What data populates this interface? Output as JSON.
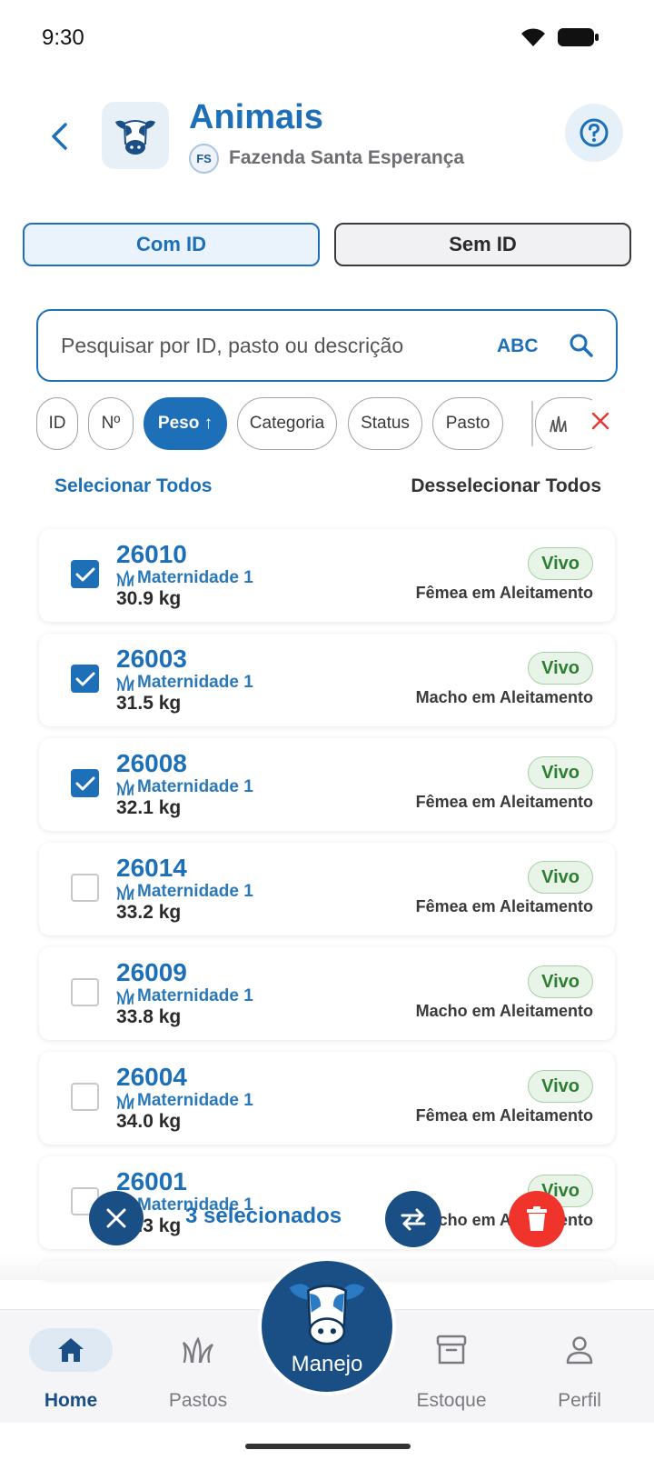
{
  "status_bar": {
    "time": "9:30"
  },
  "header": {
    "title": "Animais",
    "farm_initials": "FS",
    "farm_name": "Fazenda Santa Esperança"
  },
  "segments": {
    "with_id": "Com ID",
    "without_id": "Sem ID"
  },
  "search": {
    "placeholder": "Pesquisar por ID, pasto ou descrição",
    "mode_label": "ABC"
  },
  "filters": {
    "chips": [
      {
        "label": "ID"
      },
      {
        "label": "Nº"
      },
      {
        "label": "Peso ↑",
        "active": true
      },
      {
        "label": "Categoria"
      },
      {
        "label": "Status"
      },
      {
        "label": "Pasto"
      }
    ]
  },
  "selection": {
    "select_all": "Selecionar Todos",
    "deselect_all": "Desselecionar Todos",
    "count_label": "3 selecionados"
  },
  "animals": [
    {
      "id": "26010",
      "pasture": "Maternidade 1",
      "weight": "30.9 kg",
      "status": "Vivo",
      "category": "Fêmea em Aleitamento",
      "checked": true
    },
    {
      "id": "26003",
      "pasture": "Maternidade 1",
      "weight": "31.5 kg",
      "status": "Vivo",
      "category": "Macho em Aleitamento",
      "checked": true
    },
    {
      "id": "26008",
      "pasture": "Maternidade 1",
      "weight": "32.1 kg",
      "status": "Vivo",
      "category": "Fêmea em Aleitamento",
      "checked": true
    },
    {
      "id": "26014",
      "pasture": "Maternidade 1",
      "weight": "33.2 kg",
      "status": "Vivo",
      "category": "Fêmea em Aleitamento",
      "checked": false
    },
    {
      "id": "26009",
      "pasture": "Maternidade 1",
      "weight": "33.8 kg",
      "status": "Vivo",
      "category": "Macho em Aleitamento",
      "checked": false
    },
    {
      "id": "26004",
      "pasture": "Maternidade 1",
      "weight": "34.0 kg",
      "status": "Vivo",
      "category": "Fêmea em Aleitamento",
      "checked": false
    },
    {
      "id": "26001",
      "pasture": "Maternidade 1",
      "weight": "34.3 kg",
      "status": "Vivo",
      "category": "Macho em Aleitamento",
      "checked": false
    }
  ],
  "bottom_nav": {
    "home": "Home",
    "pastures": "Pastos",
    "manage": "Manejo",
    "stock": "Estoque",
    "profile": "Perfil"
  },
  "colors": {
    "primary": "#1d6fb8",
    "dark_primary": "#1a4f85",
    "danger": "#f0342c",
    "success": "#2e7d32"
  },
  "icons": [
    "back-arrow-icon",
    "cow-icon",
    "help-icon",
    "search-icon",
    "grass-icon",
    "close-icon",
    "transfer-icon",
    "trash-icon",
    "home-icon",
    "stock-box-icon",
    "profile-icon"
  ]
}
